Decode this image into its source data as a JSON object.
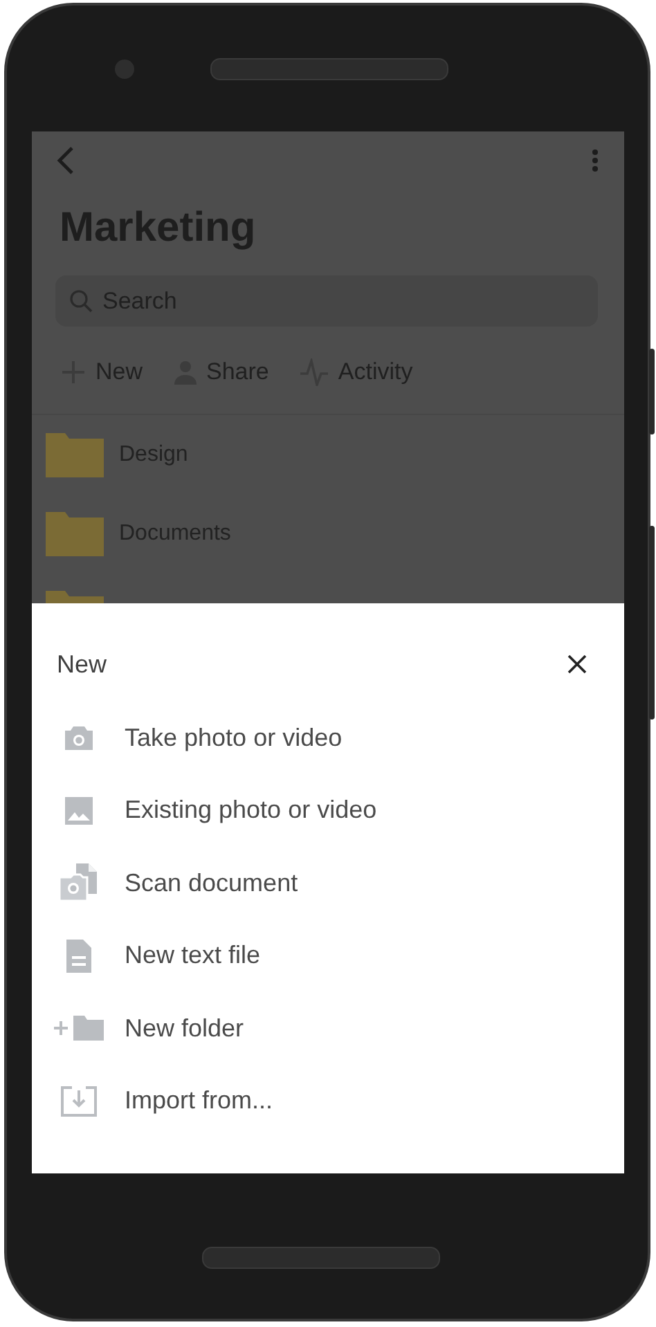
{
  "header": {
    "title": "Marketing"
  },
  "search": {
    "placeholder": "Search"
  },
  "toolbar": [
    {
      "label": "New",
      "kind": "new"
    },
    {
      "label": "Share",
      "kind": "share"
    },
    {
      "label": "Activity",
      "kind": "activity"
    }
  ],
  "folders": [
    {
      "name": "Design"
    },
    {
      "name": "Documents"
    }
  ],
  "sheet": {
    "title": "New",
    "items": [
      {
        "label": "Take photo or video",
        "kind": "camera"
      },
      {
        "label": "Existing photo or video",
        "kind": "image"
      },
      {
        "label": "Scan document",
        "kind": "scan"
      },
      {
        "label": "New text file",
        "kind": "textfile"
      },
      {
        "label": "New folder",
        "kind": "folder"
      },
      {
        "label": "Import from...",
        "kind": "import"
      }
    ]
  }
}
